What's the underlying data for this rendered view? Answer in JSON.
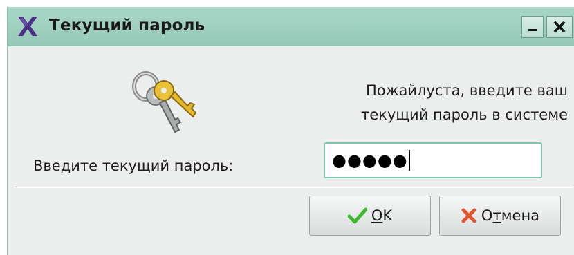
{
  "window": {
    "title": "Текущий пароль",
    "minimize_label": "_",
    "close_label": "✕"
  },
  "message": {
    "line1": "Пожайлуста, введите ваш",
    "line2": "текущий пароль в системе"
  },
  "form": {
    "label": "Введите текущий пароль:",
    "password_mask": "●●●●●"
  },
  "buttons": {
    "ok": {
      "mnemonic": "O",
      "rest": "K"
    },
    "cancel": {
      "prefix": "О",
      "mnemonic": "т",
      "rest": "мена"
    }
  },
  "icons": {
    "app": "x-logo-icon",
    "keys": "keys-icon",
    "ok": "checkmark-icon",
    "cancel": "cross-icon"
  },
  "colors": {
    "titlebar": "#9fd0bf",
    "input_border": "#7fc7b0",
    "ok_check": "#3bb82a",
    "cancel_cross": "#e2542c"
  }
}
